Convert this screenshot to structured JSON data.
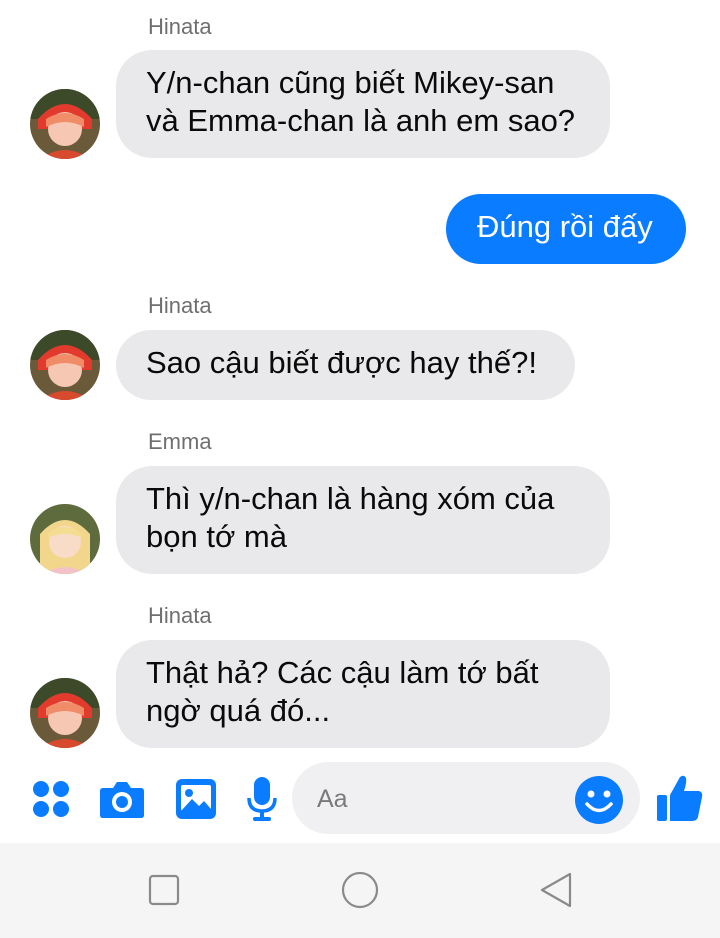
{
  "messages": [
    {
      "sender": "Hinata",
      "direction": "in",
      "lines": [
        "Y/n-chan cũng biết Mikey-san",
        "và Emma-chan là anh em sao?"
      ]
    },
    {
      "direction": "out",
      "lines": [
        "Đúng rồi đấy"
      ]
    },
    {
      "sender": "Hinata",
      "direction": "in",
      "lines": [
        "Sao cậu biết được hay thế?!"
      ]
    },
    {
      "sender": "Emma",
      "direction": "in",
      "lines": [
        "Thì y/n-chan là hàng xóm của",
        "bọn tớ mà"
      ]
    },
    {
      "sender": "Hinata",
      "direction": "in",
      "lines": [
        "Thật hả? Các cậu làm tớ bất",
        "ngờ quá đó..."
      ]
    }
  ],
  "composer": {
    "placeholder": "Aa",
    "icons": [
      "apps-grid-icon",
      "camera-icon",
      "image-icon",
      "microphone-icon",
      "emoji-icon",
      "like-thumbs-up-icon"
    ]
  },
  "navbar": {
    "icons": [
      "recent-apps-square-icon",
      "home-circle-icon",
      "back-triangle-icon"
    ]
  },
  "colors": {
    "accent": "#0a7cff",
    "incoming_bubble": "#e9e9eb",
    "sender_label": "#6f6f6f"
  }
}
